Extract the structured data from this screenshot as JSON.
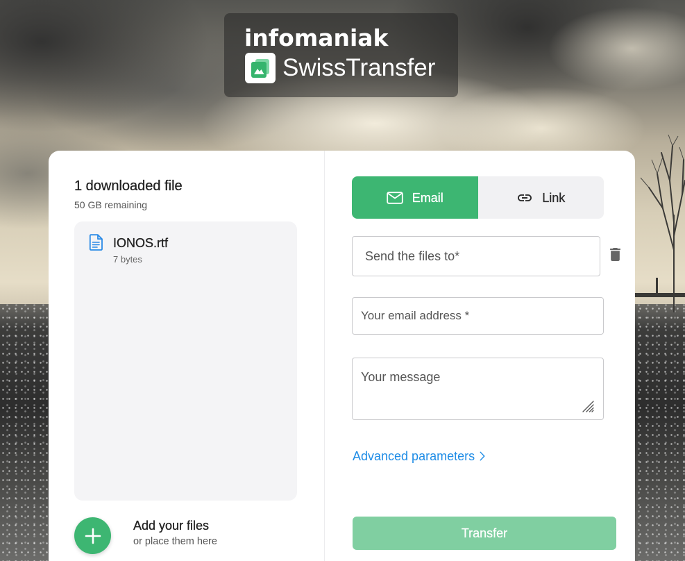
{
  "header": {
    "brand": "infomaniak",
    "product": "SwissTransfer",
    "logo_icon": "swisstransfer-logo-icon"
  },
  "files_panel": {
    "title": "1 downloaded file",
    "remaining": "50 GB remaining",
    "files": [
      {
        "name": "IONOS.rtf",
        "size": "7 bytes",
        "icon": "document-icon"
      }
    ],
    "add_icon": "plus-icon",
    "add_title": "Add your files",
    "add_subtitle": "or place them here"
  },
  "form": {
    "tabs": [
      {
        "label": "Email",
        "icon": "mail-icon",
        "active": true
      },
      {
        "label": "Link",
        "icon": "link-icon",
        "active": false
      }
    ],
    "recipient_placeholder": "Send the files to*",
    "delete_icon": "trash-icon",
    "email_placeholder": "Your email address *",
    "message_placeholder": "Your message",
    "advanced_label": "Advanced parameters",
    "advanced_icon": "chevron-right-icon",
    "transfer_label": "Transfer"
  },
  "colors": {
    "accent": "#3db672",
    "accent_disabled": "#80cfa1",
    "link": "#1e8ce6",
    "text_primary": "#2b2b2b",
    "text_secondary": "#666666",
    "panel_bg": "#f4f4f6",
    "file_icon": "#2a8ae6"
  }
}
